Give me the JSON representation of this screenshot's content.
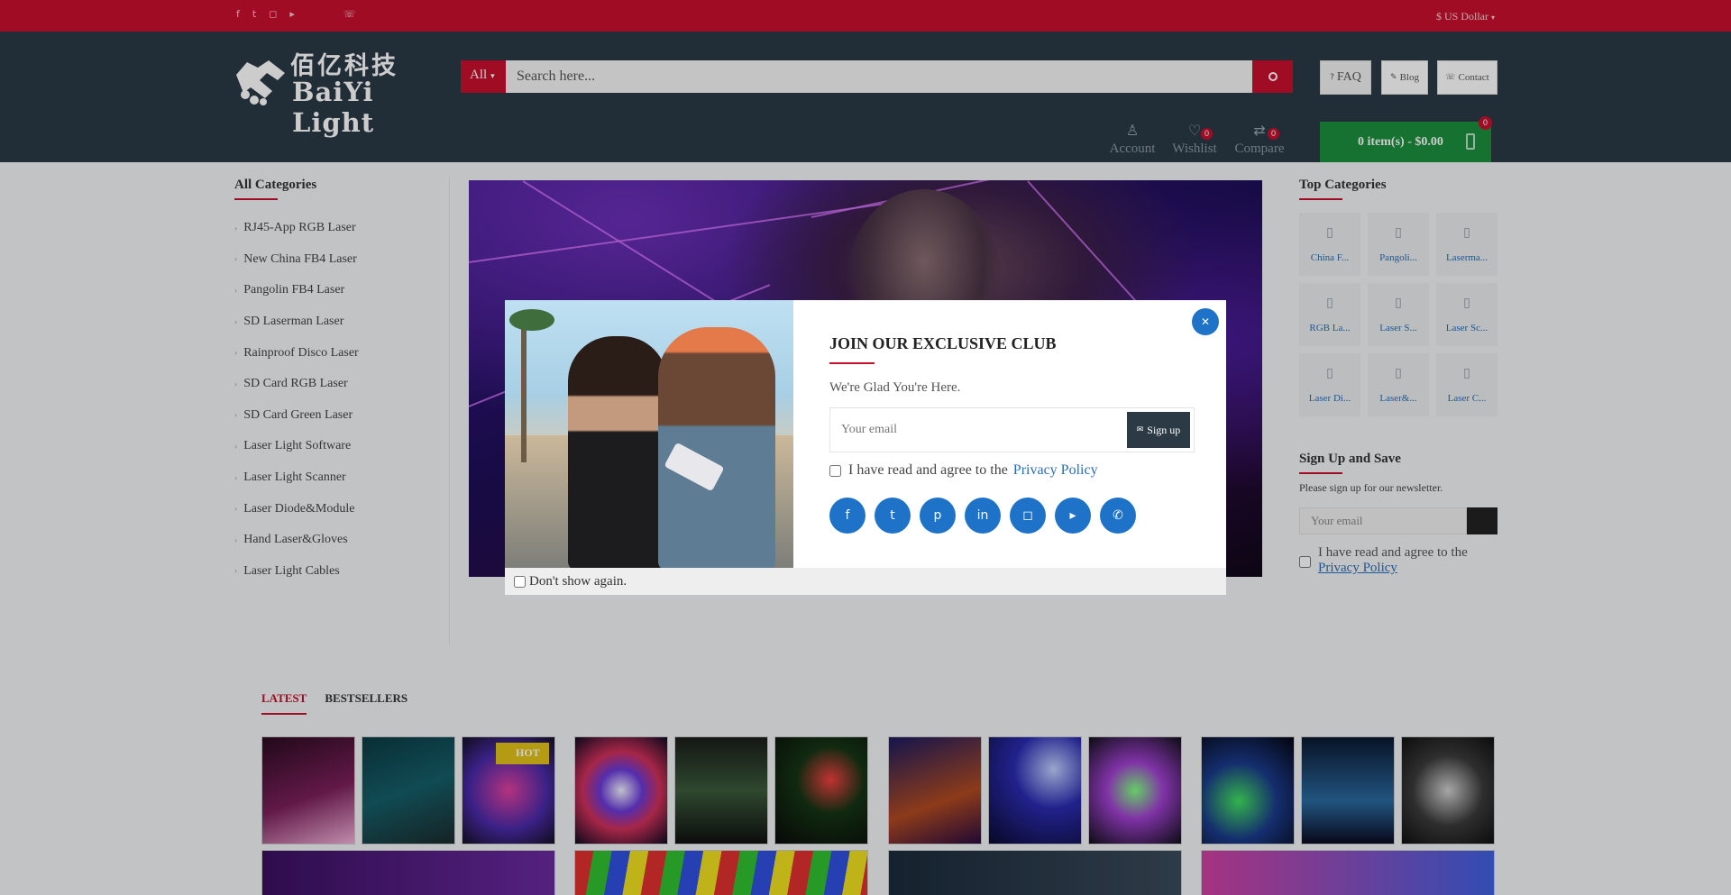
{
  "topbar": {
    "social_icons": [
      "facebook-icon",
      "twitter-icon",
      "instagram-icon",
      "youtube-icon",
      "phone-icon"
    ],
    "currency": "$ US Dollar"
  },
  "header": {
    "logo_cn": "佰亿科技",
    "logo_en": "BaiYi Light",
    "search": {
      "category": "All",
      "placeholder": "Search here..."
    },
    "links": {
      "faq": "FAQ",
      "blog": "Blog",
      "contact": "Contact"
    },
    "icons": {
      "account": "Account",
      "wishlist": "Wishlist",
      "wishlist_count": "0",
      "compare": "Compare",
      "compare_count": "0"
    },
    "cart": {
      "label": "0 item(s) - $0.00",
      "count": "0"
    }
  },
  "sidebar": {
    "title": "All Categories",
    "items": [
      "RJ45-App RGB Laser",
      "New China FB4 Laser",
      "Pangolin FB4 Laser",
      "SD Laserman Laser",
      "Rainproof Disco Laser",
      "SD Card RGB Laser",
      "SD Card Green Laser",
      "Laser Light Software",
      "Laser Light Scanner",
      "Laser Diode&Module",
      "Hand Laser&Gloves",
      "Laser Light Cables"
    ]
  },
  "top_categories": {
    "title": "Top Categories",
    "items": [
      "China F...",
      "Pangoli...",
      "Laserma...",
      "RGB La...",
      "Laser S...",
      "Laser Sc...",
      "Laser Di...",
      "Laser&...",
      "Laser C..."
    ]
  },
  "newsletter": {
    "title": "Sign Up and Save",
    "description": "Please sign up for our newsletter.",
    "placeholder": "Your email",
    "agree_text": "I have read and agree to the",
    "privacy_link": "Privacy Policy"
  },
  "tabs": {
    "latest": "LATEST",
    "bestsellers": "BESTSELLERS"
  },
  "products": {
    "hot_badge": "HOT"
  },
  "modal": {
    "title": "JOIN OUR EXCLUSIVE CLUB",
    "subtitle": "We're Glad You're Here.",
    "email_placeholder": "Your email",
    "signup_button": "Sign up",
    "agree_text": "I have read and agree to the",
    "privacy_link": "Privacy Policy",
    "dont_show": "Don't show again.",
    "social_icons": [
      "facebook-icon",
      "twitter-icon",
      "pinterest-icon",
      "linkedin-icon",
      "instagram-icon",
      "youtube-icon",
      "whatsapp-icon"
    ]
  },
  "colors": {
    "brand_red": "#c8102e",
    "header_dark": "#2b3a45",
    "cart_green": "#1b8f3c",
    "link_blue": "#2a6db8",
    "modal_blue": "#1e73c8"
  }
}
